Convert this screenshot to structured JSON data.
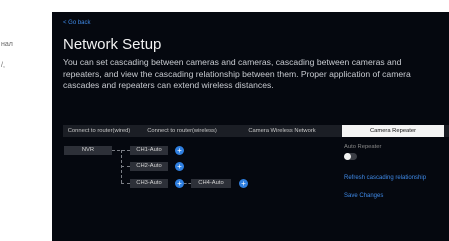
{
  "left_strip": {
    "texts": [
      "нал",
      "/,"
    ]
  },
  "header": {
    "back_label": "< Go back",
    "title": "Network Setup",
    "description": "You can set cascading between cameras and cameras, cascading between cameras and repeaters, and view the cascading relationship between them. Proper application of camera cascades and repeaters can extend wireless distances."
  },
  "tabs": [
    {
      "label": "Connect to router(wired)",
      "active": false
    },
    {
      "label": "Connect to router(wireless)",
      "active": false
    },
    {
      "label": "Camera Wireless Network",
      "active": false
    },
    {
      "label": "Camera Repeater",
      "active": true
    }
  ],
  "topology": {
    "nvr_label": "NVR",
    "cameras": [
      "CH1-Auto",
      "CH2-Auto",
      "CH3-Auto",
      "CH4-Auto"
    ],
    "add_icon": "+"
  },
  "settings": {
    "auto_repeater_label": "Auto Repeater",
    "auto_repeater_on": false,
    "refresh_label": "Refresh cascading relationship",
    "save_label": "Save Changes"
  },
  "colors": {
    "background": "#05080f",
    "accent": "#2f7fe0",
    "link": "#3f8ae8"
  }
}
